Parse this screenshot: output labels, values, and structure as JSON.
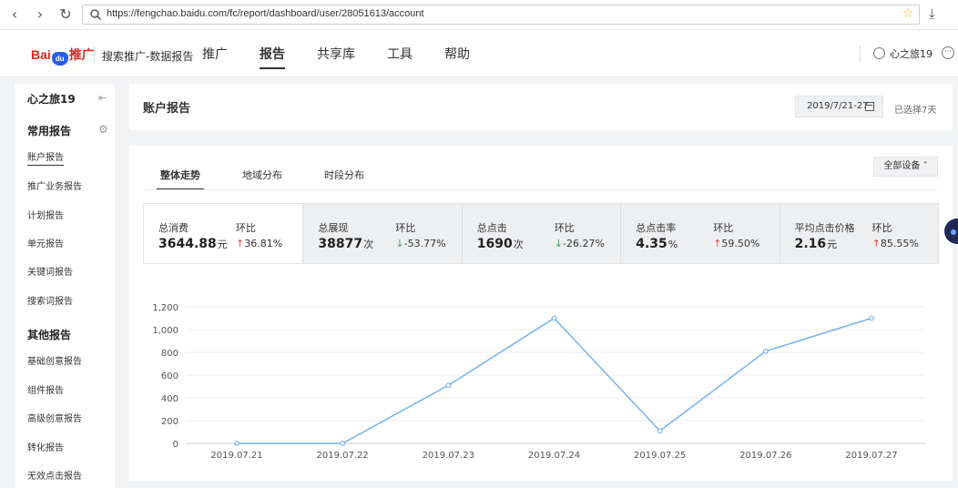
{
  "browser": {
    "url": "https://fengchao.baidu.com/fc/report/dashboard/user/28051613/account"
  },
  "header": {
    "logo_text_left": "Bai",
    "logo_paw": "du",
    "logo_text_right": "推广",
    "subtitle": "搜索推广-数据报告",
    "nav": [
      "推广",
      "报告",
      "共享库",
      "工具",
      "帮助"
    ],
    "active_nav": "报告",
    "user_name": "心之旅19"
  },
  "sidebar": {
    "account": "心之旅19",
    "section_common": "常用报告",
    "common_items": [
      "账户报告",
      "推广业务报告",
      "计划报告",
      "单元报告",
      "关键词报告",
      "搜索词报告"
    ],
    "section_other": "其他报告",
    "other_items": [
      "基础创意报告",
      "组件报告",
      "高级创意报告",
      "转化报告",
      "无效点击报告"
    ]
  },
  "title_card": {
    "title": "账户报告",
    "date_range": "2019/7/21-27",
    "selected_days": "已选择7天"
  },
  "main": {
    "tabs": [
      "整体走势",
      "地域分布",
      "时段分布"
    ],
    "device_select": "全部设备",
    "metrics": [
      {
        "label": "总消费",
        "value": "3644.88",
        "unit": "元",
        "hb_label": "环比",
        "hb_arrow": "↑",
        "hb_value": "36.81%",
        "dir": "up"
      },
      {
        "label": "总展现",
        "value": "38877",
        "unit": "次",
        "hb_label": "环比",
        "hb_arrow": "↓",
        "hb_value": "-53.77%",
        "dir": "down"
      },
      {
        "label": "总点击",
        "value": "1690",
        "unit": "次",
        "hb_label": "环比",
        "hb_arrow": "↓",
        "hb_value": "-26.27%",
        "dir": "down"
      },
      {
        "label": "总点击率",
        "value": "4.35",
        "unit": "%",
        "hb_label": "环比",
        "hb_arrow": "↑",
        "hb_value": "59.50%",
        "dir": "up"
      },
      {
        "label": "平均点击价格",
        "value": "2.16",
        "unit": "元",
        "hb_label": "环比",
        "hb_arrow": "↑",
        "hb_value": "85.55%",
        "dir": "up"
      }
    ]
  },
  "chart_data": {
    "type": "line",
    "categories": [
      "2019.07.21",
      "2019.07.22",
      "2019.07.23",
      "2019.07.24",
      "2019.07.25",
      "2019.07.26",
      "2019.07.27"
    ],
    "values": [
      0,
      0,
      510,
      1100,
      110,
      810,
      1100
    ],
    "ylim": [
      0,
      1200
    ],
    "yticks": [
      0,
      200,
      400,
      600,
      800,
      1000,
      1200
    ],
    "ytick_labels": [
      "0",
      "200",
      "400",
      "600",
      "800",
      "1,000",
      "1,200"
    ],
    "grid": true,
    "line_color": "#73b4f2"
  }
}
